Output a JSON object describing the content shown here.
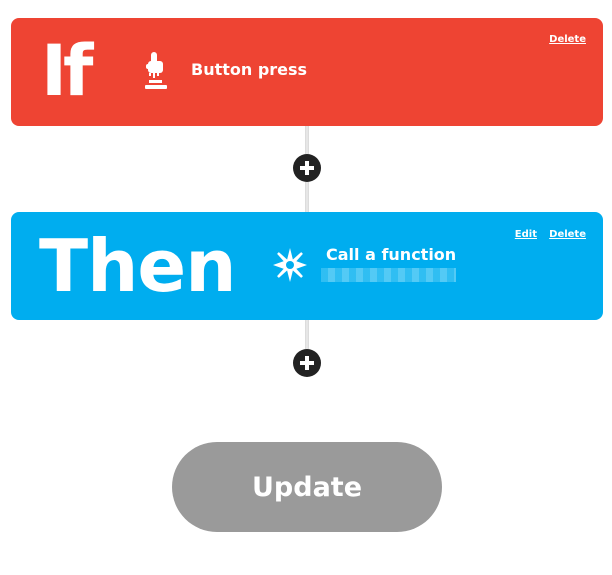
{
  "colors": {
    "trigger_card": "#ee4433",
    "action_card": "#00adef",
    "add_button": "#222222",
    "update_button": "#9a9a9a",
    "text": "#ffffff"
  },
  "trigger": {
    "keyword": "If",
    "icon": "button-press-icon",
    "label": "Button press",
    "delete_label": "Delete"
  },
  "action": {
    "keyword": "Then",
    "icon": "spark-icon",
    "label": "Call a function",
    "edit_label": "Edit",
    "delete_label": "Delete"
  },
  "add_step": {
    "icon": "plus-icon"
  },
  "update_label": "Update"
}
